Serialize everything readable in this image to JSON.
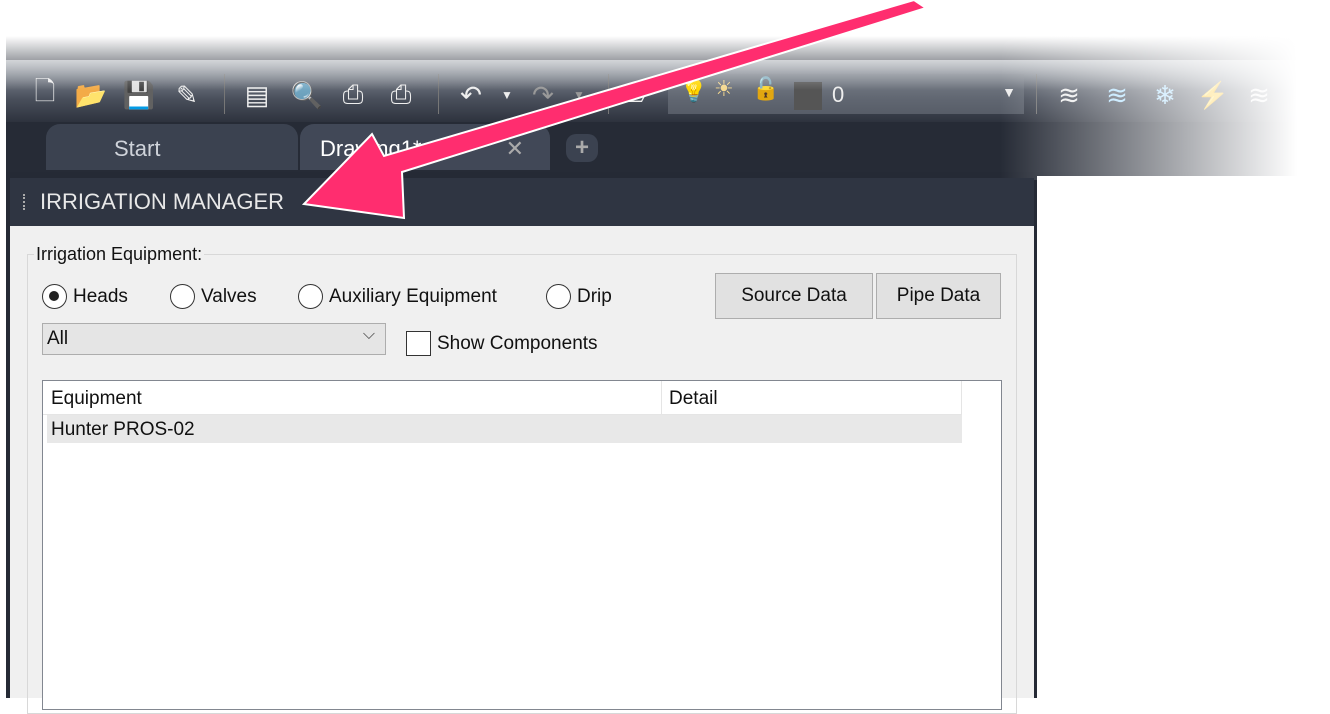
{
  "toolbar": {
    "icons": [
      "new-icon",
      "open-icon",
      "save-icon",
      "save-as-icon",
      "sheet-set-icon",
      "plot-preview-icon",
      "plot-icon",
      "publish-icon",
      "undo-icon",
      "redo-icon",
      "layer-match-icon",
      "bulb-on-icon",
      "sun-icon",
      "unlock-icon",
      "color-swatch-icon",
      "layer-previous-icon",
      "layer-isolate-icon",
      "layer-freeze-icon",
      "layer-off-icon",
      "layer-unisolate-icon"
    ],
    "layer_value": "0"
  },
  "tabs": [
    {
      "label": "Start"
    },
    {
      "label": "Drawing1*"
    }
  ],
  "panel": {
    "title": "IRRIGATION MANAGER",
    "group_label": "Irrigation Equipment:",
    "radios": [
      {
        "label": "Heads",
        "checked": true
      },
      {
        "label": "Valves",
        "checked": false
      },
      {
        "label": "Auxiliary Equipment",
        "checked": false
      },
      {
        "label": "Drip",
        "checked": false
      }
    ],
    "buttons": {
      "source": "Source Data",
      "pipe": "Pipe Data"
    },
    "filter": "All",
    "show_components": "Show Components",
    "list": {
      "columns": [
        "Equipment",
        "Detail"
      ],
      "rows": [
        {
          "equipment": "Hunter PROS-02",
          "detail": ""
        }
      ]
    }
  },
  "annotation": {
    "arrow_color": "#ff2d6f"
  }
}
